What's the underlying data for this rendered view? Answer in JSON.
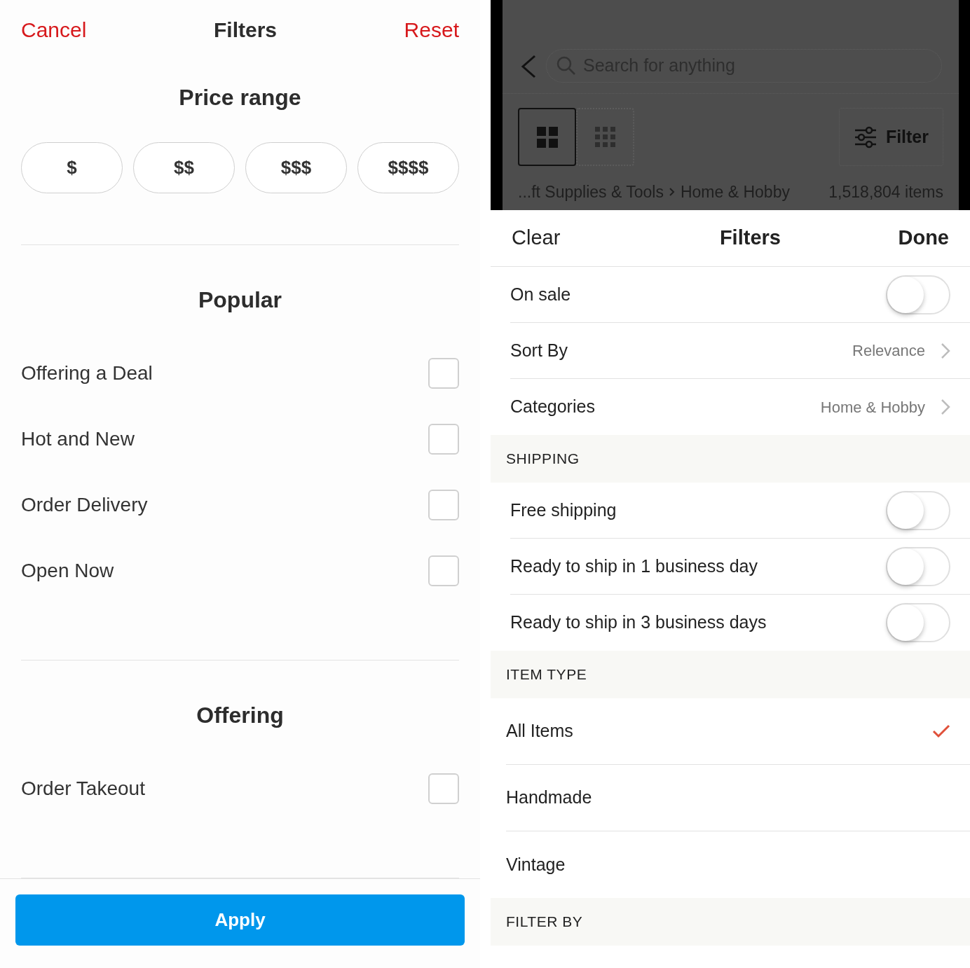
{
  "left": {
    "header": {
      "cancel": "Cancel",
      "title": "Filters",
      "reset": "Reset"
    },
    "price_range": {
      "title": "Price range",
      "options": [
        {
          "label": "$",
          "selected": false
        },
        {
          "label": "$$",
          "selected": false
        },
        {
          "label": "$$$",
          "selected": false
        },
        {
          "label": "$$$$",
          "selected": false
        }
      ]
    },
    "sections": [
      {
        "title": "Popular",
        "items": [
          {
            "label": "Offering a Deal",
            "checked": false
          },
          {
            "label": "Hot and New",
            "checked": false
          },
          {
            "label": "Order Delivery",
            "checked": false
          },
          {
            "label": "Open Now",
            "checked": false
          }
        ]
      },
      {
        "title": "Offering",
        "items": [
          {
            "label": "Order Takeout",
            "checked": false
          }
        ]
      }
    ],
    "apply": "Apply"
  },
  "right": {
    "search": {
      "placeholder": "Search for anything"
    },
    "views": [
      {
        "kind": "large",
        "selected": true
      },
      {
        "kind": "small",
        "selected": false
      }
    ],
    "filter_button": "Filter",
    "breadcrumb": [
      "...ft Supplies & Tools",
      "Home & Hobby"
    ],
    "count": "1,518,804 items",
    "sheet_header": {
      "clear": "Clear",
      "title": "Filters",
      "done": "Done"
    },
    "rows": [
      {
        "kind": "toggle",
        "label": "On sale",
        "on": false
      },
      {
        "kind": "link",
        "label": "Sort By",
        "value": "Relevance"
      },
      {
        "kind": "link",
        "label": "Categories",
        "value": "Home & Hobby"
      },
      {
        "kind": "section",
        "label": "SHIPPING"
      },
      {
        "kind": "toggle",
        "label": "Free shipping",
        "on": false
      },
      {
        "kind": "toggle",
        "label": "Ready to ship in 1 business day",
        "on": false
      },
      {
        "kind": "toggle",
        "label": "Ready to ship in 3 business days",
        "on": false
      },
      {
        "kind": "section",
        "label": "ITEM TYPE"
      },
      {
        "kind": "option",
        "label": "All Items",
        "selected": true
      },
      {
        "kind": "option",
        "label": "Handmade",
        "selected": false
      },
      {
        "kind": "option",
        "label": "Vintage",
        "selected": false
      },
      {
        "kind": "section",
        "label": "FILTER BY"
      }
    ]
  }
}
